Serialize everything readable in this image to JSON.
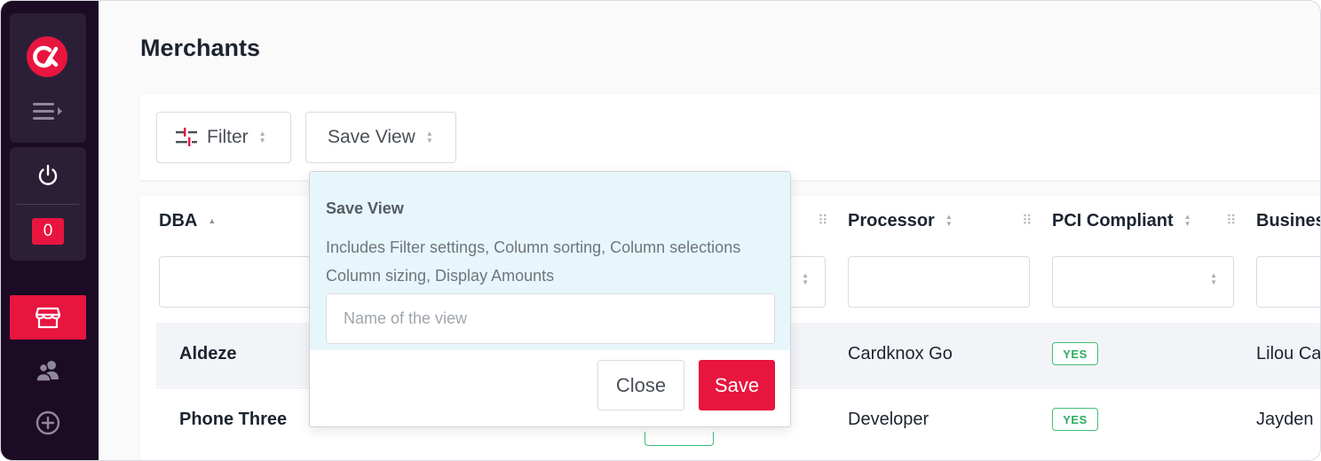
{
  "app": {
    "logo_icon": "brand-logo-icon",
    "accent_color": "#e8153f",
    "sidebar_color": "#1c0b25"
  },
  "sidebar": {
    "notification_count": "0",
    "items": [
      {
        "icon": "menu-expand-icon"
      },
      {
        "icon": "power-icon"
      },
      {
        "icon": "store-icon",
        "active": true
      },
      {
        "icon": "users-icon"
      },
      {
        "icon": "plus-circle-icon"
      }
    ]
  },
  "page": {
    "title": "Merchants"
  },
  "toolbar": {
    "filter_label": "Filter",
    "save_view_label": "Save View"
  },
  "table": {
    "columns": [
      {
        "label": "DBA",
        "sort": "asc"
      },
      {
        "label": "Processor",
        "sort": "none"
      },
      {
        "label": "PCI Compliant",
        "sort": "none"
      },
      {
        "label": "Busines",
        "sort": "none"
      }
    ],
    "rows": [
      {
        "dba": "Aldeze",
        "processor": "Cardknox Go",
        "pci": "YES",
        "business": "Lilou Ca"
      },
      {
        "dba": "Phone Three",
        "processor": "Developer",
        "pci": "YES",
        "business": "Jayden"
      }
    ]
  },
  "save_view_popover": {
    "title": "Save View",
    "description": "Includes Filter settings, Column sorting, Column selections Column sizing, Display Amounts",
    "input_value": "",
    "input_placeholder": "Name of the view",
    "close_label": "Close",
    "save_label": "Save"
  }
}
